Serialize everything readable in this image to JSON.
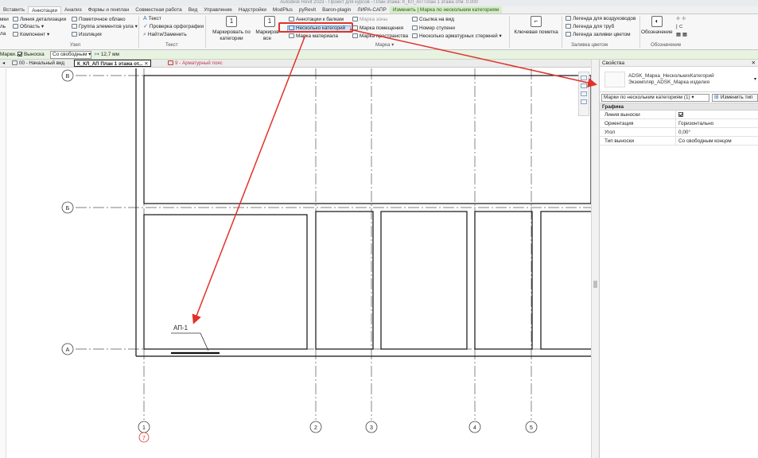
{
  "title_strip": "Autodesk Revit 2023 - Проект для курсов - План этажа: К_КЛ_АП План 1 этажа отм. 0.000",
  "ribbon_tabs": [
    {
      "label": "Вставить"
    },
    {
      "label": "Аннотации",
      "active": true
    },
    {
      "label": "Анализ"
    },
    {
      "label": "Формы и генплан"
    },
    {
      "label": "Совместная работа"
    },
    {
      "label": "Вид"
    },
    {
      "label": "Управление"
    },
    {
      "label": "Надстройки"
    },
    {
      "label": "ModPlus"
    },
    {
      "label": "pyRevit"
    },
    {
      "label": "Baron-plagin"
    },
    {
      "label": "ЛИРА-САПР"
    },
    {
      "label": "Изменить | Марка по нескольким категориям",
      "context": true
    }
  ],
  "ribbon": {
    "left_col": [
      "мки",
      "ль",
      "ла"
    ],
    "detail_group": {
      "items": [
        "Линия детализации",
        "Область",
        "Компонент"
      ]
    },
    "detail_group2": {
      "items": [
        "Пометочное облако",
        "Группа элементов узла",
        "Изоляция"
      ]
    },
    "panel_node": "Узел",
    "text_group": {
      "items": [
        "Текст",
        "Проверка орфографии",
        "Найти/Заменить"
      ]
    },
    "panel_text": "Текст",
    "tag_by_category": {
      "line1": "Маркировать по",
      "line2": "категории"
    },
    "tag_all": {
      "line1": "Маркиров",
      "line2": "все"
    },
    "tag_col1": [
      "Аннотации к балкам",
      "Несколько категорий",
      "Марка материала"
    ],
    "tag_col2": [
      "Марка зоны",
      "Марка помещения",
      "Марка пространства"
    ],
    "tag_col3": [
      "Ссылка на вид",
      "Номер ступени",
      "Несколько арматурных стержней"
    ],
    "panel_tag": "Марка",
    "keynote": "Ключевая пометка",
    "color_fill": [
      "Легенда для воздуховодов",
      "Легенда для труб",
      "Легенда заливки цветом"
    ],
    "panel_color_fill": "Заливка цветом",
    "symbol": "Обозначение",
    "panel_symbol": "Обозначение"
  },
  "options_bar": {
    "label": "Марки...",
    "leader_label": "Выноска",
    "leader_checked": true,
    "leader_type": "Со свободным",
    "length": "12,7 мм"
  },
  "view_tabs": [
    {
      "label": "00 - Начальный вид"
    },
    {
      "label": "К_КЛ_АП План 1 этажа от...",
      "active": true
    },
    {
      "label": "9 - Арматурный пояс",
      "pink": true
    }
  ],
  "drawing": {
    "grid_rows": [
      "В",
      "Б",
      "А"
    ],
    "grid_cols": [
      "1",
      "2",
      "3",
      "4",
      "5"
    ],
    "revision_mark": "7",
    "tag_text": "АП-1"
  },
  "properties": {
    "title": "Свойства",
    "type_line1": "ADSK_Марка_НесколькихКатегорий",
    "type_line2": "Экземпляр_ADSK_Марка изделия",
    "filter": "Марки по нескольким категориям (1)",
    "edit_type": "Изменить тип",
    "group": "Графика",
    "rows": [
      {
        "name": "Линия выноски",
        "value": "",
        "checkbox": true
      },
      {
        "name": "Ориентация",
        "value": "Горизонтально"
      },
      {
        "name": "Угол",
        "value": "0,00°"
      },
      {
        "name": "Тип выноски",
        "value": "Со свободным концом"
      }
    ]
  },
  "colors": {
    "accent": "#e0322a",
    "context_tab": "#d6ecc9",
    "options_bar": "#e8f2e1"
  }
}
